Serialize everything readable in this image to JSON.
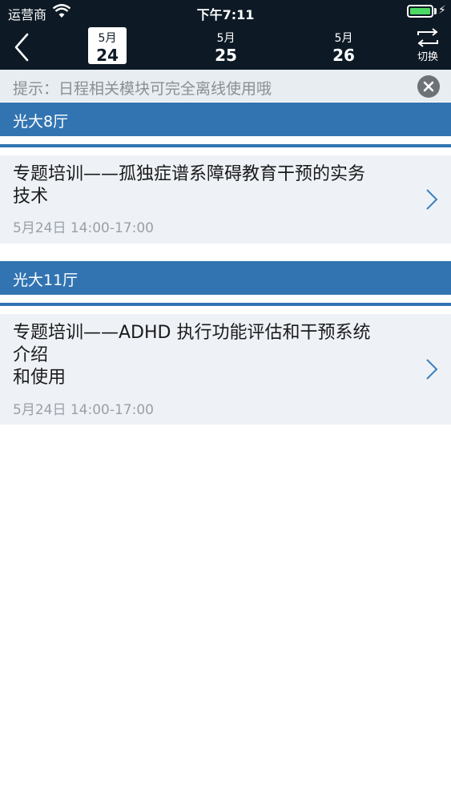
{
  "status_bar": {
    "carrier": "运营商",
    "time": "下午7:11"
  },
  "nav": {
    "dates": [
      {
        "month": "5月",
        "day": "24",
        "active": true
      },
      {
        "month": "5月",
        "day": "25",
        "active": false
      },
      {
        "month": "5月",
        "day": "26",
        "active": false
      }
    ],
    "switch_label": "切换"
  },
  "tip": {
    "text": "提示：日程相关模块可完全离线使用哦"
  },
  "sections": [
    {
      "venue": "光大8厅",
      "sessions": [
        {
          "title_lines": [
            "专题培训——孤独症谱系障碍教育干预的实务",
            "技术"
          ],
          "time": "5月24日 14:00-17:00"
        }
      ]
    },
    {
      "venue": "光大11厅",
      "sessions": [
        {
          "title_lines": [
            "专题培训——ADHD 执行功能评估和干预系统",
            "介绍",
            "和使用"
          ],
          "time": "5月24日 14:00-17:00"
        }
      ]
    }
  ],
  "colors": {
    "header_bg": "#0d1a26",
    "venue_bar": "#3274b2",
    "tip_bg": "#e8edf2",
    "session_bg": "#eef2f7",
    "battery": "#4cd964"
  }
}
